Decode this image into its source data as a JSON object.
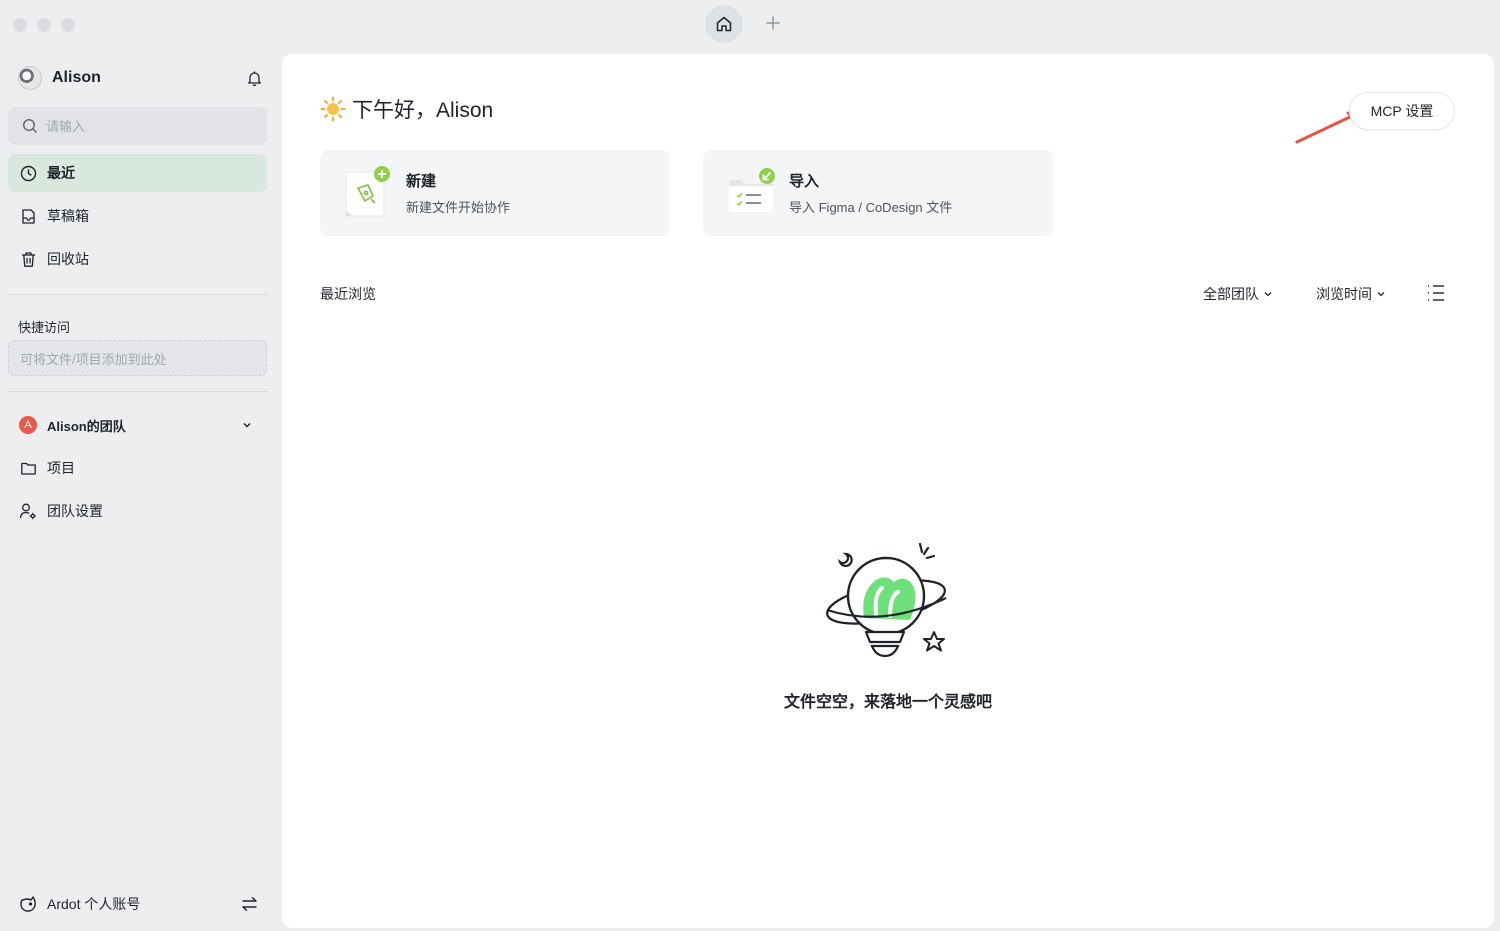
{
  "titlebar": {
    "tabs": [
      {
        "name": "home",
        "icon": "home-icon"
      },
      {
        "name": "new-tab",
        "icon": "plus-icon"
      }
    ]
  },
  "sidebar": {
    "user_name": "Alison",
    "search_placeholder": "请输入",
    "nav": [
      {
        "label": "最近",
        "icon": "clock-icon",
        "active": true
      },
      {
        "label": "草稿箱",
        "icon": "draft-icon",
        "active": false
      },
      {
        "label": "回收站",
        "icon": "trash-icon",
        "active": false
      }
    ],
    "quick_access_title": "快捷访问",
    "quick_access_hint": "可将文件/项目添加到此处",
    "team_badge": "A",
    "team_name": "Alison的团队",
    "team_items": [
      {
        "label": "项目",
        "icon": "folder-icon"
      },
      {
        "label": "团队设置",
        "icon": "team-settings-icon"
      }
    ],
    "account_label": "Ardot 个人账号"
  },
  "main": {
    "greeting": "下午好，Alison",
    "mcp_label": "MCP 设置",
    "cards": [
      {
        "title": "新建",
        "subtitle": "新建文件开始协作",
        "icon": "new-file-icon"
      },
      {
        "title": "导入",
        "subtitle": "导入 Figma / CoDesign 文件",
        "icon": "import-file-icon"
      }
    ],
    "recent_title": "最近浏览",
    "filters": {
      "team": "全部团队",
      "sort": "浏览时间"
    },
    "empty_text": "文件空空，来落地一个灵感吧"
  },
  "colors": {
    "accent_green": "#8fd04a",
    "active_nav_bg": "#d9e8df",
    "annotation_arrow": "#e5553f",
    "team_badge": "#e8594d"
  }
}
